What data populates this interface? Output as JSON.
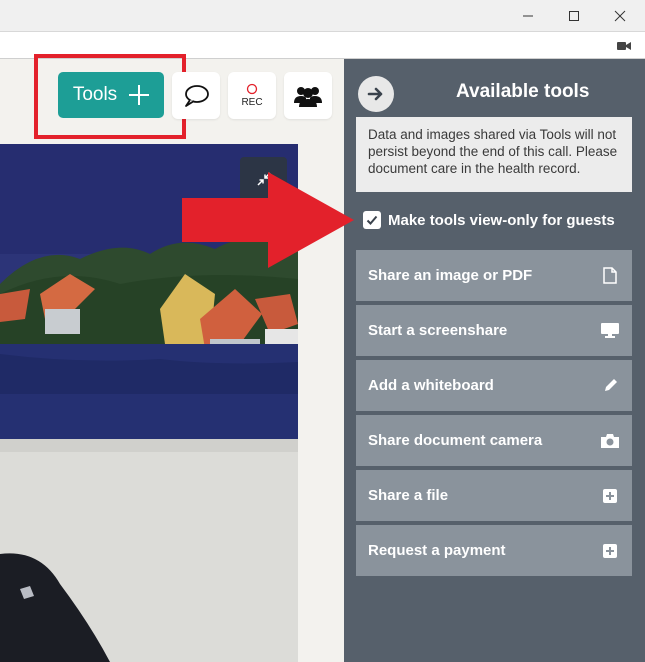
{
  "window": {
    "controls": [
      "minimize-icon",
      "maximize-icon",
      "close-icon"
    ],
    "camera_indicator_icon": "video-camera-icon"
  },
  "toolbar": {
    "tools_label": "Tools",
    "tools_icon": "plus-icon",
    "chat_icon": "speech-bubble-icon",
    "rec_label": "REC",
    "participants_icon": "people-group-icon",
    "accent_color": "#1d9e96"
  },
  "video": {
    "collapse_icon": "collapse-arrows-icon"
  },
  "annotations": {
    "highlight_color": "#e3212b"
  },
  "panel": {
    "back_icon": "arrow-right-icon",
    "title": "Available tools",
    "notice": "Data and images shared via Tools will not persist beyond the end of this call. Please document care in the health record.",
    "view_only_label": "Make tools view-only for guests",
    "view_only_checked": true,
    "tools": [
      {
        "label": "Share an image or PDF",
        "icon": "document-icon"
      },
      {
        "label": "Start a screenshare",
        "icon": "monitor-icon"
      },
      {
        "label": "Add a whiteboard",
        "icon": "pencil-icon"
      },
      {
        "label": "Share document camera",
        "icon": "camera-icon"
      },
      {
        "label": "Share a file",
        "icon": "plus-box-icon"
      },
      {
        "label": "Request a payment",
        "icon": "plus-box-icon"
      }
    ]
  }
}
